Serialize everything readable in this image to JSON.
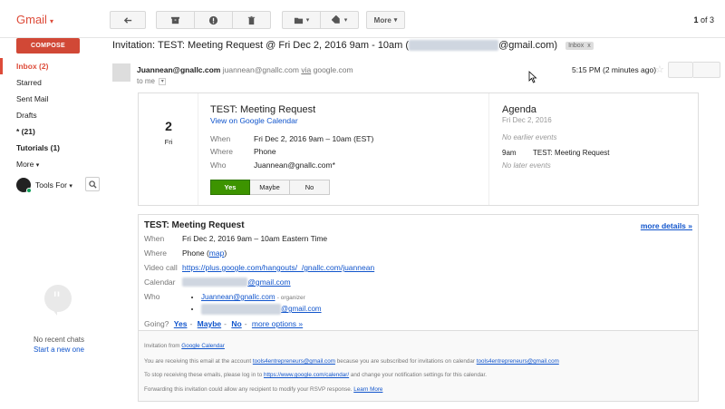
{
  "header": {
    "logo": "Gmail",
    "more_label": "More",
    "pager_bold": "1",
    "pager_rest": "of 3"
  },
  "nav": {
    "compose": "COMPOSE",
    "items": [
      "Inbox (2)",
      "Starred",
      "Sent Mail",
      "Drafts",
      "* (21)",
      "Tutorials (1)",
      "More"
    ]
  },
  "hangouts": {
    "name": "Tools For",
    "no_chats": "No recent chats",
    "start_new": "Start a new one"
  },
  "message": {
    "subject_prefix": "Invitation: TEST: Meeting Request @ Fri Dec 2, 2016 9am - 10am (",
    "subject_suffix": "@gmail.com)",
    "inbox_tag": "Inbox",
    "inbox_tag_close": "x",
    "sender_name": "Juannean@gnallc.com",
    "sender_email": "juannean@gnallc.com",
    "via_label": "via",
    "via_domain": "google.com",
    "to": "to me",
    "time": "5:15 PM (2 minutes ago)"
  },
  "invite": {
    "day_num": "2",
    "day_name": "Fri",
    "title": "TEST: Meeting Request",
    "view_link": "View on Google Calendar",
    "rows": [
      {
        "label": "When",
        "value": "Fri Dec 2, 2016 9am – 10am (EST)"
      },
      {
        "label": "Where",
        "value": "Phone"
      },
      {
        "label": "Who",
        "value": "Juannean@gnallc.com*"
      }
    ],
    "rsvp": {
      "yes": "Yes",
      "maybe": "Maybe",
      "no": "No"
    }
  },
  "agenda": {
    "title": "Agenda",
    "date": "Fri Dec 2, 2016",
    "no_earlier": "No earlier events",
    "event_time": "9am",
    "event_title": "TEST: Meeting Request",
    "no_later": "No later events"
  },
  "details": {
    "title": "TEST: Meeting Request",
    "more_details": "more details »",
    "when_label": "When",
    "when_value": "Fri Dec 2, 2016 9am – 10am Eastern Time",
    "where_label": "Where",
    "where_value": "Phone (",
    "where_map": "map",
    "where_close": ")",
    "video_label": "Video call",
    "video_link": "https://plus.google.com/hangouts/_/gnallc.com/juannean",
    "calendar_label": "Calendar",
    "calendar_suffix": "@gmail.com",
    "who_label": "Who",
    "who_1": "Juannean@gnallc.com",
    "who_1_role": "- organizer",
    "who_2_suffix": "@gmail.com",
    "going_label": "Going?",
    "going_yes": "Yes",
    "going_maybe": "Maybe",
    "going_no": "No",
    "going_more": "more options »",
    "sep": "-"
  },
  "footer": {
    "line1_pre": "Invitation from",
    "line1_link": "Google Calendar",
    "line2_pre": "You are receiving this email at the account",
    "line2_email1": "tools4entrepreneurs@gmail.com",
    "line2_mid": "because you are subscribed for invitations on calendar",
    "line2_email2": "tools4entrepreneurs@gmail.com",
    "line3_pre": "To stop receiving these emails, please log in to",
    "line3_link": "https://www.google.com/calendar/",
    "line3_post": "and change your notification settings for this calendar.",
    "line4_pre": "Forwarding this invitation could allow any recipient to modify your RSVP response.",
    "line4_link": "Learn More"
  },
  "colors": {
    "brand_red": "#dd4b39",
    "compose_red": "#d14836",
    "link_blue": "#1155cc",
    "rsvp_green": "#3d9400"
  },
  "icons": [
    "back-arrow-icon",
    "archive-icon",
    "spam-icon",
    "trash-icon",
    "folder-icon",
    "label-icon",
    "search-icon",
    "star-icon",
    "quote-icon"
  ]
}
